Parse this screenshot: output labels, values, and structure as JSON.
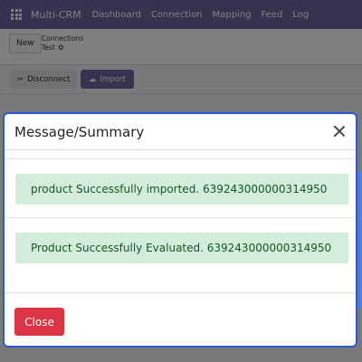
{
  "navbar": {
    "brand": "Multi-CRM",
    "links": [
      "Dashboard",
      "Connection",
      "Mapping",
      "Feed",
      "Log"
    ]
  },
  "control": {
    "new_label": "New",
    "breadcrumb_parent": "Connections",
    "breadcrumb_current": "Test"
  },
  "actions": {
    "disconnect_label": "Disconnect",
    "import_label": "Import"
  },
  "modal": {
    "title": "Message/Summary",
    "messages": [
      "product Successfully imported. 639243000000314950",
      "Product Successfully Evaluated. 639243000000314950"
    ],
    "close_label": "Close"
  },
  "colors": {
    "navbar": "#71639e",
    "alert_bg": "#d4edda",
    "alert_text": "#155724",
    "close_button": "#dc3545",
    "modal_border": "#2b58d6"
  }
}
